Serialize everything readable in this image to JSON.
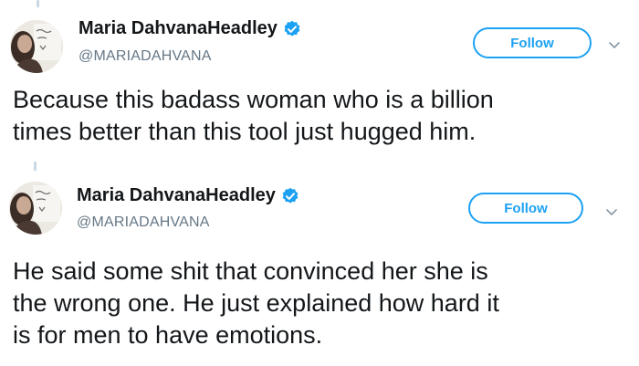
{
  "tweets": [
    {
      "display_name": "Maria DahvanaHeadley",
      "handle": "@MARIADAHVANA",
      "verified_icon": "verified-badge-icon",
      "follow_label": "Follow",
      "menu_icon": "chevron-down-icon",
      "text": "Because this badass woman who is a billion\ntimes better than this tool just hugged him."
    },
    {
      "display_name": "Maria DahvanaHeadley",
      "handle": "@MARIADAHVANA",
      "verified_icon": "verified-badge-icon",
      "follow_label": "Follow",
      "menu_icon": "chevron-down-icon",
      "text": "He said some shit that convinced her she is\nthe wrong one. He just explained how hard it\nis for men to have emotions."
    }
  ],
  "colors": {
    "accent": "#1da1f2",
    "text": "#14171a",
    "secondary": "#657786",
    "thread_line": "#c8d8e4"
  }
}
